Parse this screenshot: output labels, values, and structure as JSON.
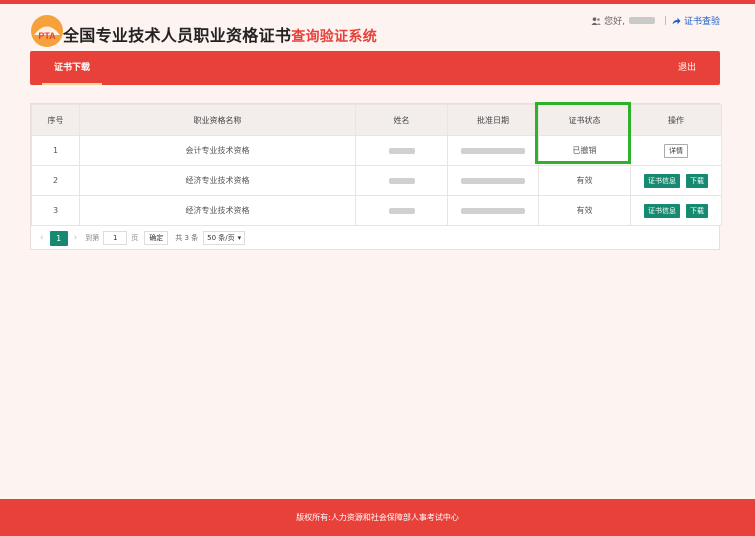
{
  "header": {
    "logo_text": "PTA",
    "title_main": "全国专业技术人员职业资格证书",
    "title_accent": "查询验证系统",
    "greeting": "您好,",
    "verify_link": "证书查验"
  },
  "nav": {
    "active_tab": "证书下载",
    "logout": "退出"
  },
  "table": {
    "headers": [
      "序号",
      "职业资格名称",
      "姓名",
      "批准日期",
      "证书状态",
      "操作"
    ],
    "rows": [
      {
        "index": "1",
        "name": "会计专业技术资格",
        "status": "已撤销",
        "actions": [
          "详情"
        ]
      },
      {
        "index": "2",
        "name": "经济专业技术资格",
        "status": "有效",
        "actions": [
          "证书信息",
          "下载"
        ]
      },
      {
        "index": "3",
        "name": "经济专业技术资格",
        "status": "有效",
        "actions": [
          "证书信息",
          "下载"
        ]
      }
    ]
  },
  "pagination": {
    "current_page": "1",
    "goto_label": "到第",
    "goto_value": "1",
    "page_unit": "页",
    "ok": "确定",
    "total": "共 3 条",
    "page_size": "50 条/页"
  },
  "footer": {
    "copyright": "版权所有:人力资源和社会保障部人事考试中心"
  },
  "colors": {
    "brand_red": "#e8413a",
    "action_green": "#168a70",
    "highlight_green": "#2fb12b",
    "link_blue": "#1a5ecf"
  }
}
